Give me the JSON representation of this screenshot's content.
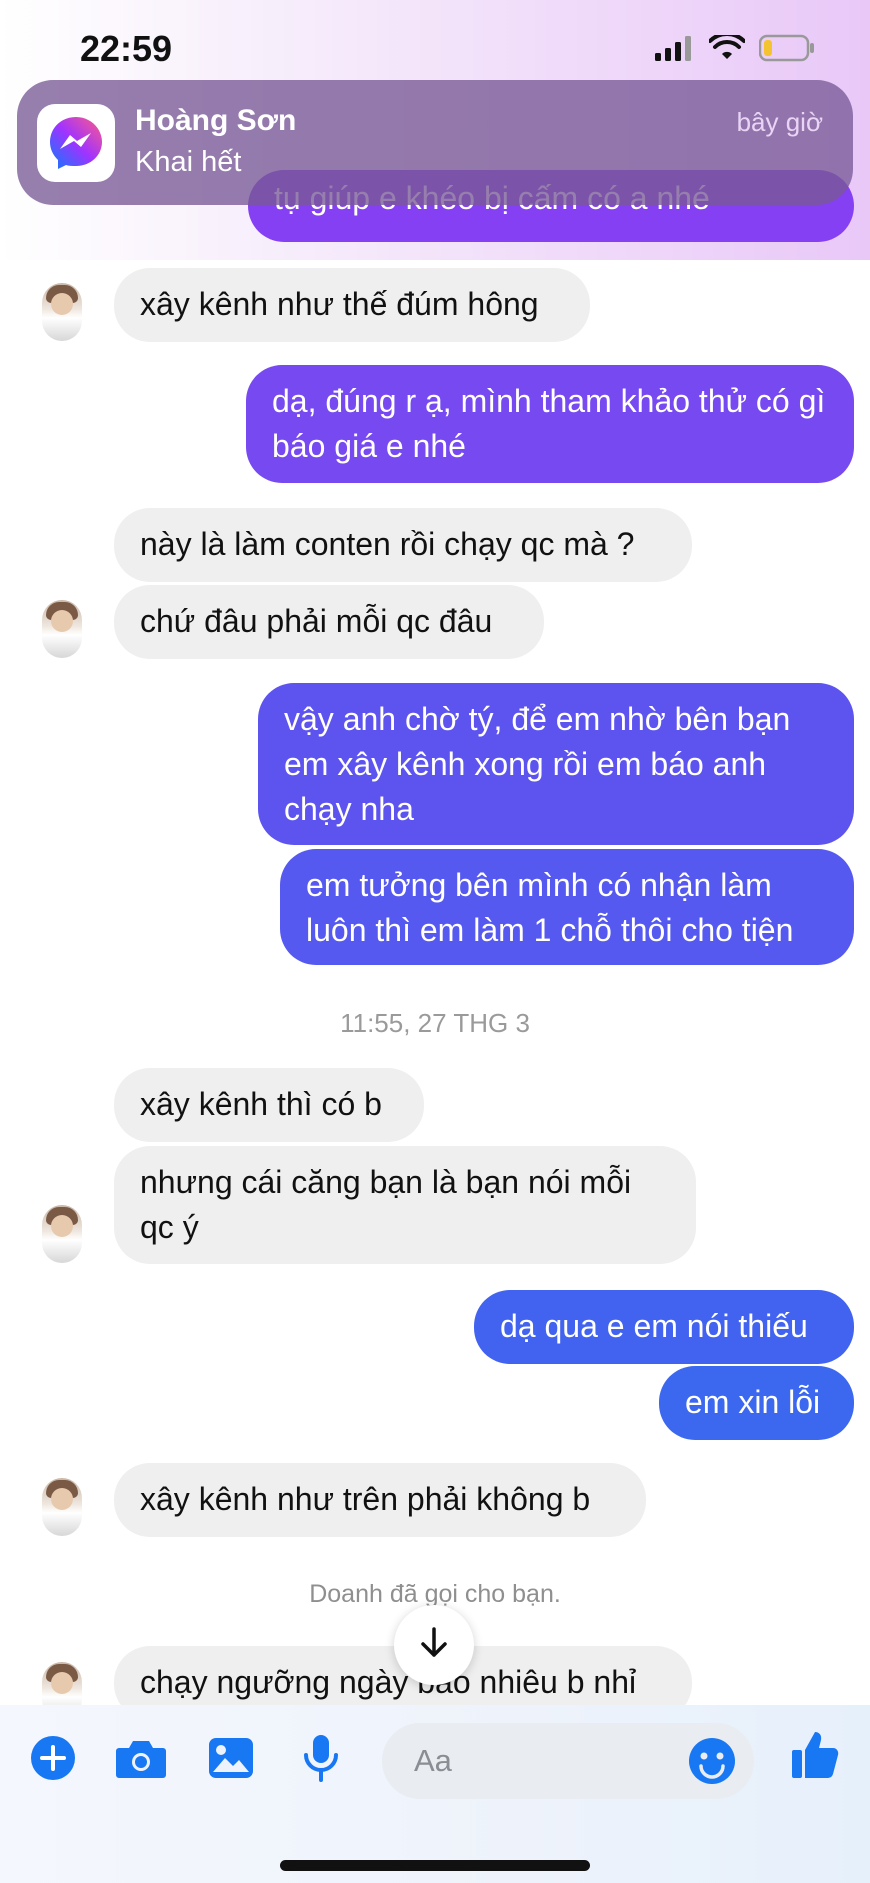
{
  "status_bar": {
    "time": "22:59",
    "battery_level": 0.2
  },
  "notification": {
    "sender": "Hoàng Sơn",
    "message": "Khai hết",
    "time": "bây giờ"
  },
  "messages": {
    "m0": "tụ giúp e khéo bị cấm có a nhé",
    "m1": "xây kênh như thế đúm hông",
    "m2": "dạ, đúng r ạ, mình tham khảo thử có gì báo giá e nhé",
    "m3": "này là làm conten rồi chạy qc mà ?",
    "m4": "chứ đâu phải mỗi qc đâu",
    "m5": "vậy anh chờ tý, để em nhờ bên bạn em xây kênh xong rồi em báo anh chạy nha",
    "m6": "em tưởng bên mình có nhận làm luôn thì em làm 1 chỗ thôi cho tiện",
    "timestamp": "11:55, 27 THG 3",
    "m7": "xây kênh thì có b",
    "m8": "nhưng cái căng bạn là bạn nói mỗi qc ý",
    "m9": "dạ qua e em nói thiếu",
    "m10": "em xin lỗi",
    "m11": "xây kênh như trên phải không b",
    "call_notice": "Doanh đã gọi cho bạn.",
    "m12": "chạy ngưỡng ngày bao nhiêu b nhỉ"
  },
  "composer": {
    "placeholder": "Aa"
  },
  "colors": {
    "accent": "#1877f2",
    "outgoing_top": "#8b3ff2",
    "outgoing_mid": "#6a4cf0",
    "outgoing_bottom": "#3c68ef",
    "incoming_bg": "#efefef"
  },
  "icons": [
    "plus-icon",
    "camera-icon",
    "image-icon",
    "microphone-icon",
    "emoji-icon",
    "like-icon",
    "arrow-down-icon",
    "messenger-icon"
  ]
}
